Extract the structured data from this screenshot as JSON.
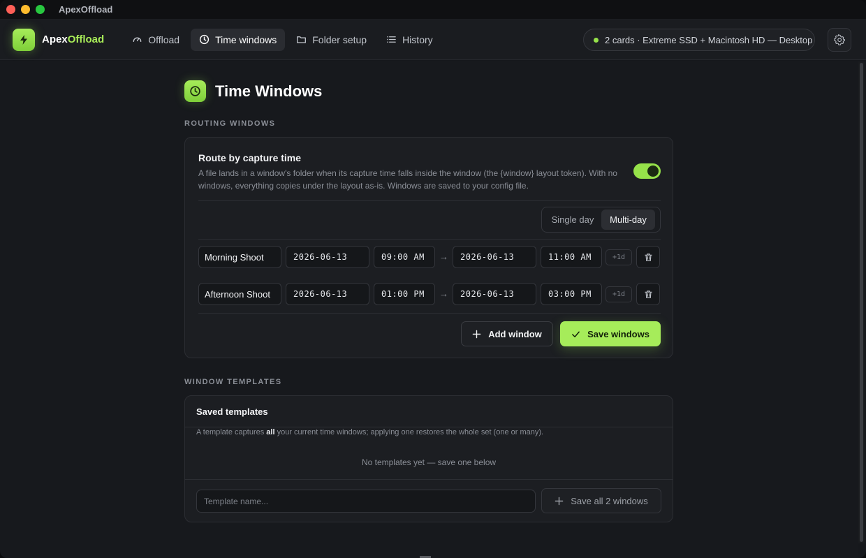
{
  "app": {
    "window_title": "ApexOffload",
    "brand_prefix": "Apex",
    "brand_suffix": "Offload"
  },
  "nav": [
    {
      "label": "Offload",
      "icon": "gauge-icon"
    },
    {
      "label": "Time windows",
      "icon": "clock-icon",
      "active": true
    },
    {
      "label": "Folder setup",
      "icon": "folder-icon"
    },
    {
      "label": "History",
      "icon": "list-icon"
    }
  ],
  "device": {
    "status": "2 cards · Extreme SSD + Macintosh HD — Desktop",
    "status_color": "#96e24a"
  },
  "page": {
    "title": "Time Windows"
  },
  "routing": {
    "section_label": "ROUTING WINDOWS",
    "title": "Route by capture time",
    "description": "A file lands in a window's folder when its capture time falls inside the window (the {window} layout token). With no windows, everything copies under the layout as-is. Windows are saved to your config file.",
    "enabled": true,
    "mode_single": "Single day",
    "mode_multi": "Multi-day",
    "mode_selected": "Multi-day",
    "windows": [
      {
        "name": "Morning Shoot",
        "start_date": "2026-06-13",
        "start_time": "09:00 AM",
        "end_date": "2026-06-13",
        "end_time": "11:00 AM",
        "plus_day": "+1d"
      },
      {
        "name": "Afternoon Shoot",
        "start_date": "2026-06-13",
        "start_time": "01:00 PM",
        "end_date": "2026-06-13",
        "end_time": "03:00 PM",
        "plus_day": "+1d"
      }
    ],
    "arrow": "→",
    "add_label": "Add window",
    "save_label": "Save windows"
  },
  "templates": {
    "section_label": "WINDOW TEMPLATES",
    "title": "Saved templates",
    "desc_before": "A template captures ",
    "desc_bold": "all",
    "desc_after": " your current time windows; applying one restores the whole set (one or many).",
    "empty": "No templates yet — save one below",
    "input_placeholder": "Template name...",
    "save_all_label": "Save all 2 windows"
  },
  "colors": {
    "accent": "#a6ec5a",
    "background": "#17191d",
    "card": "#1c1e22"
  }
}
